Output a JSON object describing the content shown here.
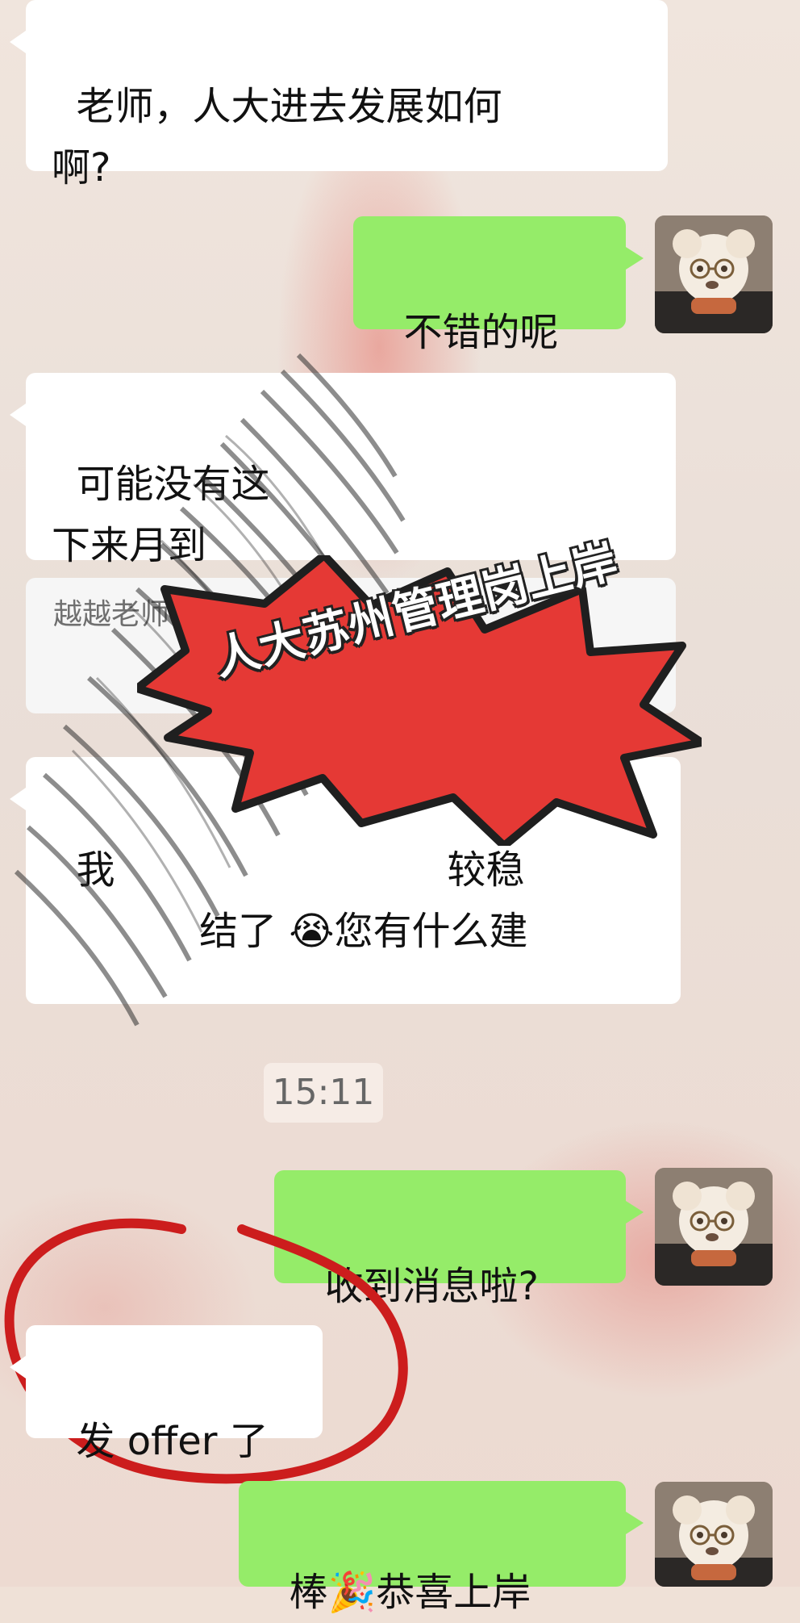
{
  "messages": [
    {
      "sender": "other",
      "text": "老师，人大进去发展如何\n啊?"
    },
    {
      "sender": "me",
      "text": "不错的呢"
    },
    {
      "sender": "other",
      "text": "可能没有这\n下来月到"
    },
    {
      "sender": "other_quote",
      "text": "越越老师\n人大还"
    },
    {
      "sender": "other",
      "text": "我                           较稳\n            结了 😭您有什么建"
    },
    {
      "sender": "me",
      "text": "收到消息啦?"
    },
    {
      "sender": "other",
      "text": "发 offer 了"
    },
    {
      "sender": "me",
      "text": "棒🎉恭喜上岸"
    }
  ],
  "timestamp": "15:11",
  "overlay_sticker": {
    "text": "人大苏州管理岗上岸",
    "background_color": "#e53935",
    "text_color": "#ffffff"
  },
  "avatar": {
    "icon": "dog-avatar-icon"
  },
  "colors": {
    "green_bubble": "#95ec69",
    "white_bubble": "#ffffff",
    "highlight_circle": "#cc1d1d"
  }
}
